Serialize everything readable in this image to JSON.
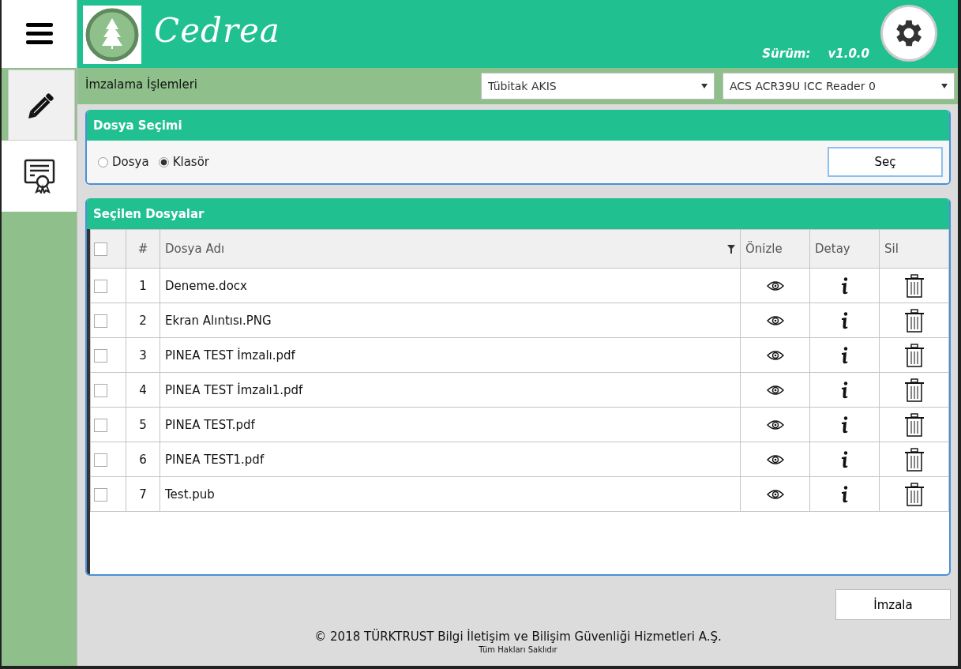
{
  "sidebar": {
    "items": [
      {
        "kind": "pencil",
        "selected": true
      },
      {
        "kind": "certificate",
        "selected": false
      }
    ]
  },
  "header": {
    "title": "Cedrea",
    "version_label": "Sürüm:",
    "version": "v1.0.0"
  },
  "toolbar": {
    "title": "İmzalama İşlemleri",
    "selects": [
      {
        "value": "Tübitak AKIS"
      },
      {
        "value": "ACS ACR39U ICC Reader 0"
      }
    ]
  },
  "file_selection": {
    "title": "Dosya Seçimi",
    "options": [
      {
        "label": "Dosya",
        "selected": false
      },
      {
        "label": "Klasör",
        "selected": true
      }
    ],
    "button": "Seç"
  },
  "selected_files": {
    "title": "Seçilen Dosyalar",
    "header_checked": false,
    "columns": [
      "#",
      "Dosya Adı",
      "Önizle",
      "Detay",
      "Sil"
    ],
    "rows": [
      {
        "checked": false,
        "index": "1",
        "name": "Deneme.docx"
      },
      {
        "checked": false,
        "index": "2",
        "name": "Ekran Alıntısı.PNG"
      },
      {
        "checked": false,
        "index": "3",
        "name": "PINEA TEST İmzalı.pdf"
      },
      {
        "checked": false,
        "index": "4",
        "name": "PINEA TEST İmzalı1.pdf"
      },
      {
        "checked": false,
        "index": "5",
        "name": "PINEA TEST.pdf"
      },
      {
        "checked": false,
        "index": "6",
        "name": "PINEA TEST1.pdf"
      },
      {
        "checked": false,
        "index": "7",
        "name": "Test.pub"
      }
    ]
  },
  "sign_button": "İmzala",
  "footer": {
    "copyright": "© 2018 TÜRKTRUST Bilgi İletişim ve Bilişim Güvenliği Hizmetleri A.Ş.",
    "rights": "Tüm Hakları Saklıdır"
  }
}
